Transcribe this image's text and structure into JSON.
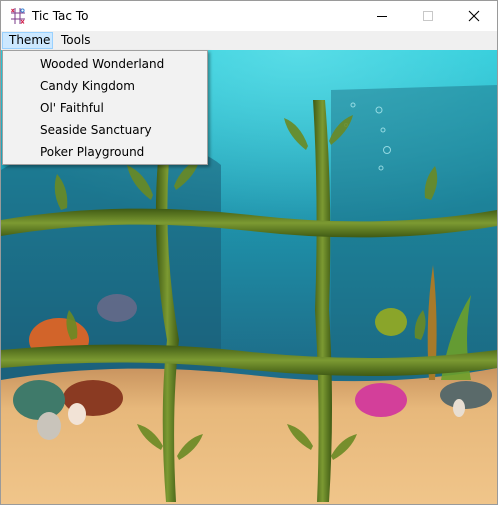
{
  "window": {
    "title": "Tic Tac To",
    "icon": "tic-tac-toe-app-icon",
    "controls": [
      "minimize-icon",
      "maximize-icon",
      "close-icon"
    ]
  },
  "menubar": {
    "items": [
      {
        "label": "Theme",
        "active": true
      },
      {
        "label": "Tools",
        "active": false
      }
    ]
  },
  "theme_menu": {
    "items": [
      {
        "label": "Wooded Wonderland"
      },
      {
        "label": "Candy Kingdom"
      },
      {
        "label": "Ol' Faithful"
      },
      {
        "label": "Seaside Sanctuary"
      },
      {
        "label": "Poker Playground"
      }
    ]
  },
  "board": {
    "theme": "underwater",
    "grid_style": "kelp-strands",
    "cells": [
      "",
      "",
      "",
      "",
      "",
      "",
      "",
      "",
      ""
    ]
  },
  "colors": {
    "water_top": "#1fb8cc",
    "water_deep": "#1f6f8a",
    "sand": "#e9b77a",
    "kelp": "#5e7a22",
    "menu_highlight": "#cce8ff"
  }
}
